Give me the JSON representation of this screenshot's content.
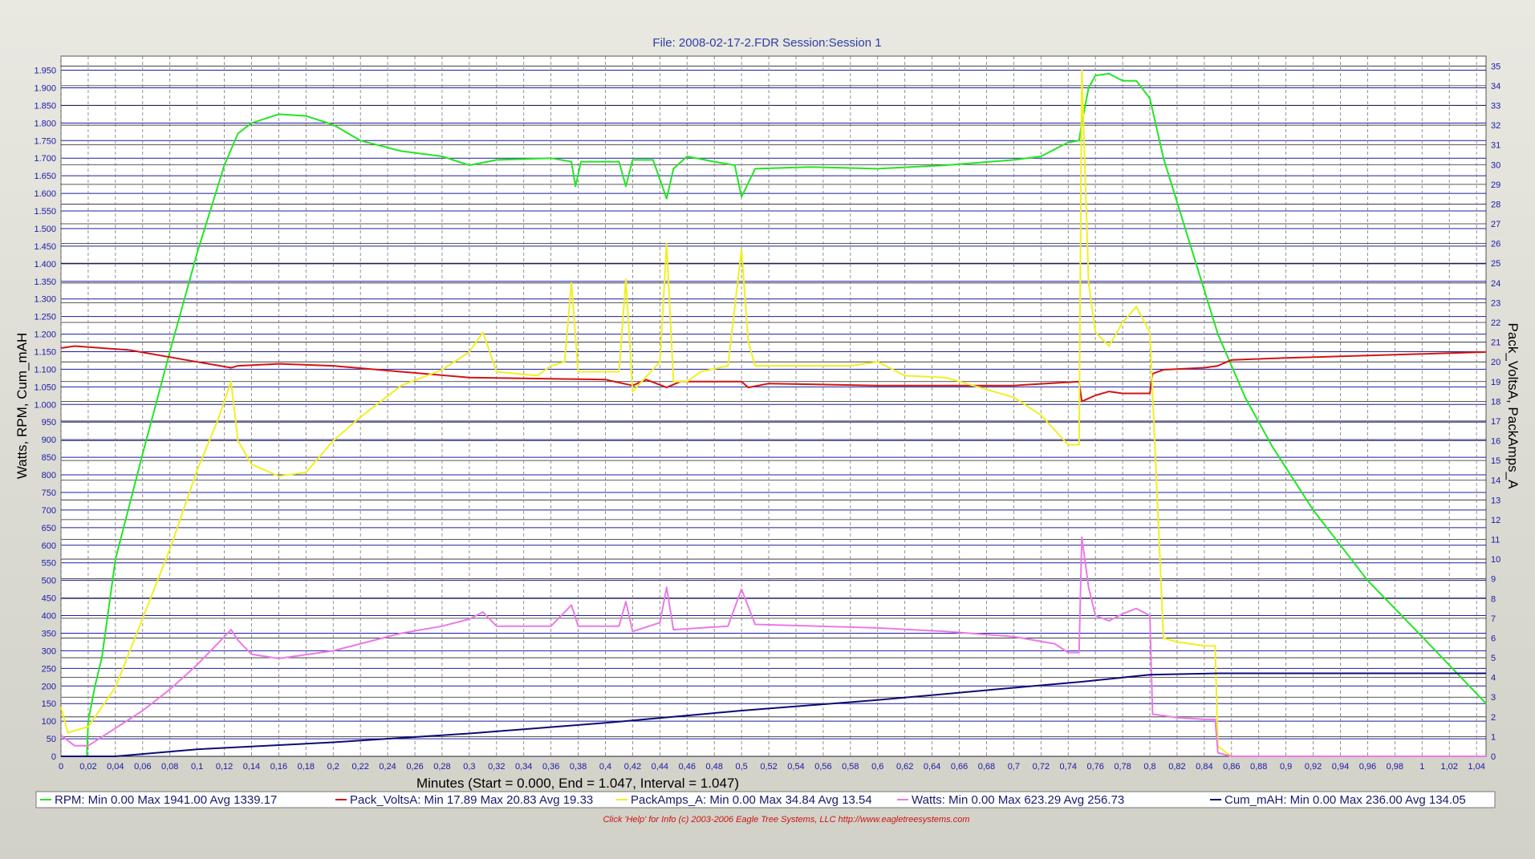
{
  "chart_data": {
    "type": "line",
    "title": "File: 2008-02-17-2.FDR   Session:Session 1",
    "xlabel": "Minutes (Start = 0.000,  End = 1.047,  Interval =  1.047)",
    "ylabel_left": "Watts, RPM, Cum_mAH",
    "ylabel_right": "Pack_VoltsA, PackAmps_A",
    "xlim": [
      0,
      1.047
    ],
    "ylim_left": [
      0,
      1990
    ],
    "ylim_right": [
      0,
      35.5
    ],
    "x_ticks": [
      "0",
      "0,02",
      "0,04",
      "0,06",
      "0,08",
      "0,1",
      "0,12",
      "0,14",
      "0,16",
      "0,18",
      "0,2",
      "0,22",
      "0,24",
      "0,26",
      "0,28",
      "0,3",
      "0,32",
      "0,34",
      "0,36",
      "0,38",
      "0,4",
      "0,42",
      "0,44",
      "0,46",
      "0,48",
      "0,5",
      "0,52",
      "0,54",
      "0,56",
      "0,58",
      "0,6",
      "0,62",
      "0,64",
      "0,66",
      "0,68",
      "0,7",
      "0,72",
      "0,74",
      "0,76",
      "0,78",
      "0,8",
      "0,82",
      "0,84",
      "0,86",
      "0,88",
      "0,9",
      "0,92",
      "0,94",
      "0,96",
      "0,98",
      "1",
      "1,02",
      "1,04"
    ],
    "y_ticks_left": [
      "0",
      "50",
      "100",
      "150",
      "200",
      "250",
      "300",
      "350",
      "400",
      "450",
      "500",
      "550",
      "600",
      "650",
      "700",
      "750",
      "800",
      "850",
      "900",
      "950",
      "1.000",
      "1.050",
      "1.100",
      "1.150",
      "1.200",
      "1.250",
      "1.300",
      "1.350",
      "1.400",
      "1.450",
      "1.500",
      "1.550",
      "1.600",
      "1.650",
      "1.700",
      "1.750",
      "1.800",
      "1.850",
      "1.900",
      "1.950"
    ],
    "y_ticks_right": [
      "0",
      "1",
      "2",
      "3",
      "4",
      "5",
      "6",
      "7",
      "8",
      "9",
      "10",
      "11",
      "12",
      "13",
      "14",
      "15",
      "16",
      "17",
      "18",
      "19",
      "20",
      "21",
      "22",
      "23",
      "24",
      "25",
      "26",
      "27",
      "28",
      "29",
      "30",
      "31",
      "32",
      "33",
      "34",
      "35"
    ],
    "series": [
      {
        "name": "RPM",
        "color": "#22e622",
        "axis": "left",
        "points": [
          [
            0,
            0
          ],
          [
            0.019,
            0
          ],
          [
            0.02,
            100
          ],
          [
            0.025,
            200
          ],
          [
            0.03,
            280
          ],
          [
            0.04,
            560
          ],
          [
            0.06,
            860
          ],
          [
            0.08,
            1150
          ],
          [
            0.1,
            1430
          ],
          [
            0.12,
            1680
          ],
          [
            0.13,
            1770
          ],
          [
            0.14,
            1800
          ],
          [
            0.16,
            1825
          ],
          [
            0.18,
            1820
          ],
          [
            0.2,
            1795
          ],
          [
            0.22,
            1750
          ],
          [
            0.25,
            1720
          ],
          [
            0.28,
            1705
          ],
          [
            0.3,
            1680
          ],
          [
            0.32,
            1695
          ],
          [
            0.36,
            1700
          ],
          [
            0.375,
            1690
          ],
          [
            0.378,
            1620
          ],
          [
            0.382,
            1690
          ],
          [
            0.41,
            1690
          ],
          [
            0.415,
            1620
          ],
          [
            0.42,
            1695
          ],
          [
            0.435,
            1695
          ],
          [
            0.445,
            1585
          ],
          [
            0.45,
            1670
          ],
          [
            0.46,
            1705
          ],
          [
            0.48,
            1690
          ],
          [
            0.495,
            1680
          ],
          [
            0.5,
            1590
          ],
          [
            0.51,
            1670
          ],
          [
            0.55,
            1675
          ],
          [
            0.6,
            1670
          ],
          [
            0.65,
            1680
          ],
          [
            0.7,
            1695
          ],
          [
            0.72,
            1705
          ],
          [
            0.74,
            1745
          ],
          [
            0.748,
            1750
          ],
          [
            0.75,
            1800
          ],
          [
            0.755,
            1900
          ],
          [
            0.76,
            1935
          ],
          [
            0.77,
            1940
          ],
          [
            0.78,
            1920
          ],
          [
            0.79,
            1920
          ],
          [
            0.8,
            1870
          ],
          [
            0.81,
            1700
          ],
          [
            0.83,
            1450
          ],
          [
            0.85,
            1200
          ],
          [
            0.87,
            1020
          ],
          [
            0.89,
            880
          ],
          [
            0.92,
            700
          ],
          [
            0.96,
            500
          ],
          [
            1.0,
            340
          ],
          [
            1.047,
            150
          ]
        ]
      },
      {
        "name": "Pack_VoltsA",
        "color": "#d21414",
        "axis": "right",
        "points": [
          [
            0,
            20.7
          ],
          [
            0.01,
            20.8
          ],
          [
            0.05,
            20.6
          ],
          [
            0.1,
            20.0
          ],
          [
            0.125,
            19.7
          ],
          [
            0.13,
            19.8
          ],
          [
            0.16,
            19.9
          ],
          [
            0.2,
            19.8
          ],
          [
            0.25,
            19.5
          ],
          [
            0.3,
            19.2
          ],
          [
            0.4,
            19.1
          ],
          [
            0.42,
            18.8
          ],
          [
            0.43,
            19.1
          ],
          [
            0.445,
            18.7
          ],
          [
            0.455,
            19.0
          ],
          [
            0.5,
            19.0
          ],
          [
            0.505,
            18.7
          ],
          [
            0.52,
            18.9
          ],
          [
            0.6,
            18.8
          ],
          [
            0.7,
            18.8
          ],
          [
            0.748,
            19.0
          ],
          [
            0.75,
            18.0
          ],
          [
            0.76,
            18.3
          ],
          [
            0.77,
            18.5
          ],
          [
            0.78,
            18.4
          ],
          [
            0.8,
            18.4
          ],
          [
            0.802,
            19.4
          ],
          [
            0.81,
            19.6
          ],
          [
            0.84,
            19.7
          ],
          [
            0.85,
            19.8
          ],
          [
            0.86,
            20.1
          ],
          [
            0.9,
            20.2
          ],
          [
            0.95,
            20.3
          ],
          [
            1.0,
            20.4
          ],
          [
            1.047,
            20.5
          ]
        ]
      },
      {
        "name": "PackAmps_A",
        "color": "#f0f020",
        "axis": "right",
        "points": [
          [
            0,
            2.5
          ],
          [
            0.005,
            1.2
          ],
          [
            0.02,
            1.5
          ],
          [
            0.04,
            3.5
          ],
          [
            0.06,
            7.0
          ],
          [
            0.08,
            10.5
          ],
          [
            0.1,
            14.5
          ],
          [
            0.115,
            17.0
          ],
          [
            0.125,
            19.0
          ],
          [
            0.13,
            16.0
          ],
          [
            0.14,
            14.8
          ],
          [
            0.16,
            14.2
          ],
          [
            0.18,
            14.4
          ],
          [
            0.2,
            16.0
          ],
          [
            0.22,
            17.2
          ],
          [
            0.25,
            18.8
          ],
          [
            0.28,
            19.6
          ],
          [
            0.3,
            20.5
          ],
          [
            0.31,
            21.5
          ],
          [
            0.32,
            19.5
          ],
          [
            0.35,
            19.3
          ],
          [
            0.36,
            19.8
          ],
          [
            0.37,
            20.0
          ],
          [
            0.375,
            24.0
          ],
          [
            0.38,
            19.5
          ],
          [
            0.41,
            19.5
          ],
          [
            0.415,
            24.2
          ],
          [
            0.42,
            18.5
          ],
          [
            0.44,
            20.0
          ],
          [
            0.445,
            26.0
          ],
          [
            0.45,
            19.0
          ],
          [
            0.46,
            19.0
          ],
          [
            0.47,
            19.5
          ],
          [
            0.49,
            19.8
          ],
          [
            0.5,
            25.7
          ],
          [
            0.505,
            21.0
          ],
          [
            0.51,
            19.8
          ],
          [
            0.55,
            19.8
          ],
          [
            0.58,
            19.8
          ],
          [
            0.6,
            20.0
          ],
          [
            0.62,
            19.3
          ],
          [
            0.65,
            19.2
          ],
          [
            0.68,
            18.6
          ],
          [
            0.7,
            18.2
          ],
          [
            0.72,
            17.3
          ],
          [
            0.74,
            15.8
          ],
          [
            0.748,
            15.8
          ],
          [
            0.75,
            34.8
          ],
          [
            0.755,
            24.0
          ],
          [
            0.76,
            21.5
          ],
          [
            0.77,
            20.8
          ],
          [
            0.78,
            22.0
          ],
          [
            0.79,
            22.8
          ],
          [
            0.8,
            21.5
          ],
          [
            0.81,
            6.0
          ],
          [
            0.82,
            5.8
          ],
          [
            0.84,
            5.6
          ],
          [
            0.848,
            5.6
          ],
          [
            0.85,
            0.5
          ],
          [
            0.86,
            0
          ],
          [
            1.047,
            0
          ]
        ]
      },
      {
        "name": "Watts",
        "color": "#ea7ae6",
        "axis": "left",
        "points": [
          [
            0,
            60
          ],
          [
            0.01,
            30
          ],
          [
            0.02,
            30
          ],
          [
            0.04,
            80
          ],
          [
            0.06,
            130
          ],
          [
            0.08,
            190
          ],
          [
            0.1,
            260
          ],
          [
            0.12,
            340
          ],
          [
            0.125,
            360
          ],
          [
            0.13,
            330
          ],
          [
            0.14,
            290
          ],
          [
            0.16,
            278
          ],
          [
            0.2,
            300
          ],
          [
            0.25,
            350
          ],
          [
            0.28,
            370
          ],
          [
            0.3,
            390
          ],
          [
            0.31,
            410
          ],
          [
            0.32,
            370
          ],
          [
            0.36,
            370
          ],
          [
            0.375,
            430
          ],
          [
            0.38,
            370
          ],
          [
            0.41,
            370
          ],
          [
            0.415,
            440
          ],
          [
            0.42,
            355
          ],
          [
            0.44,
            380
          ],
          [
            0.445,
            480
          ],
          [
            0.45,
            360
          ],
          [
            0.47,
            365
          ],
          [
            0.49,
            370
          ],
          [
            0.5,
            475
          ],
          [
            0.51,
            375
          ],
          [
            0.6,
            365
          ],
          [
            0.65,
            355
          ],
          [
            0.7,
            340
          ],
          [
            0.73,
            320
          ],
          [
            0.74,
            295
          ],
          [
            0.748,
            295
          ],
          [
            0.75,
            623
          ],
          [
            0.755,
            480
          ],
          [
            0.76,
            400
          ],
          [
            0.77,
            385
          ],
          [
            0.78,
            405
          ],
          [
            0.79,
            420
          ],
          [
            0.8,
            400
          ],
          [
            0.802,
            120
          ],
          [
            0.82,
            110
          ],
          [
            0.84,
            105
          ],
          [
            0.848,
            105
          ],
          [
            0.85,
            10
          ],
          [
            0.86,
            0
          ],
          [
            1.047,
            0
          ]
        ]
      },
      {
        "name": "Cum_mAH",
        "color": "#0c0c78",
        "axis": "left",
        "points": [
          [
            0,
            0
          ],
          [
            0.04,
            0
          ],
          [
            0.1,
            20
          ],
          [
            0.2,
            40
          ],
          [
            0.3,
            65
          ],
          [
            0.4,
            95
          ],
          [
            0.5,
            130
          ],
          [
            0.6,
            160
          ],
          [
            0.7,
            195
          ],
          [
            0.75,
            212
          ],
          [
            0.8,
            232
          ],
          [
            0.85,
            236
          ],
          [
            1.047,
            236
          ]
        ]
      }
    ],
    "legend": [
      {
        "color": "#22e622",
        "text": "RPM:  Min 0.00   Max 1941.00   Avg 1339.17"
      },
      {
        "color": "#d21414",
        "text": "Pack_VoltsA:  Min 17.89   Max 20.83   Avg 19.33"
      },
      {
        "color": "#f0f020",
        "text": "PackAmps_A:  Min 0.00   Max 34.84   Avg 13.54"
      },
      {
        "color": "#ea7ae6",
        "text": "Watts:  Min 0.00   Max 623.29   Avg 256.73"
      },
      {
        "color": "#0c0c78",
        "text": "Cum_mAH:  Min 0.00   Max 236.00   Avg 134.05"
      }
    ],
    "footer": "Click 'Help' for Info  (c) 2003-2006 Eagle Tree Systems, LLC      http://www.eagletreesystems.com",
    "grid": true,
    "legend_position": "bottom"
  }
}
